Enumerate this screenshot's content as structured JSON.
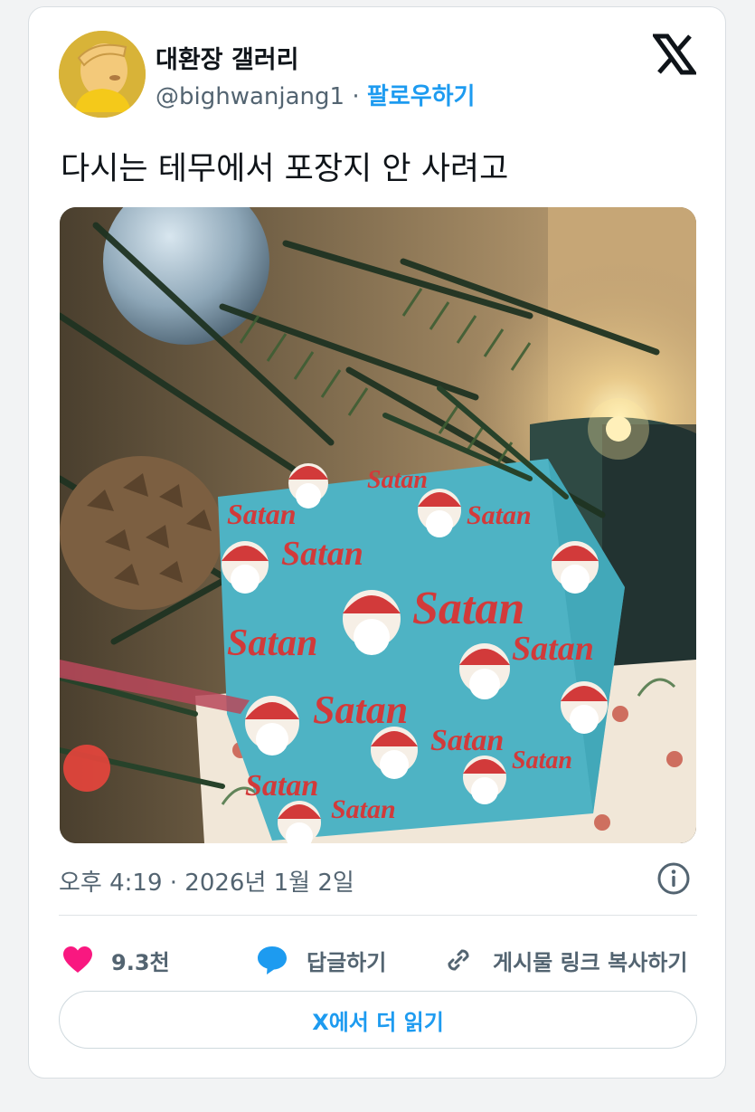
{
  "author": {
    "display_name": "대환장 갤러리",
    "handle": "@bighwanjang1",
    "separator": "·",
    "follow_label": "팔로우하기"
  },
  "post": {
    "text": "다시는 테무에서 포장지 안 사려고",
    "photo_wrap_text": [
      "Satan",
      "Satan",
      "Satan",
      "Satan",
      "Satan",
      "Satan",
      "Satan",
      "Satan",
      "Satan",
      "Satan",
      "Satan",
      "Satan"
    ],
    "timestamp": "오후 4:19 · 2026년 1월 2일"
  },
  "stats": {
    "likes": "9.3천",
    "reply_label": "답글하기",
    "copy_link_label": "게시물 링크 복사하기"
  },
  "read_more_label": "X에서 더 읽기",
  "colors": {
    "accent": "#1d9bf0",
    "like": "#f91880",
    "secondary_text": "#536471"
  },
  "icons": [
    "x-logo-icon",
    "info-icon",
    "heart-icon",
    "reply-bubble-icon",
    "link-icon"
  ]
}
